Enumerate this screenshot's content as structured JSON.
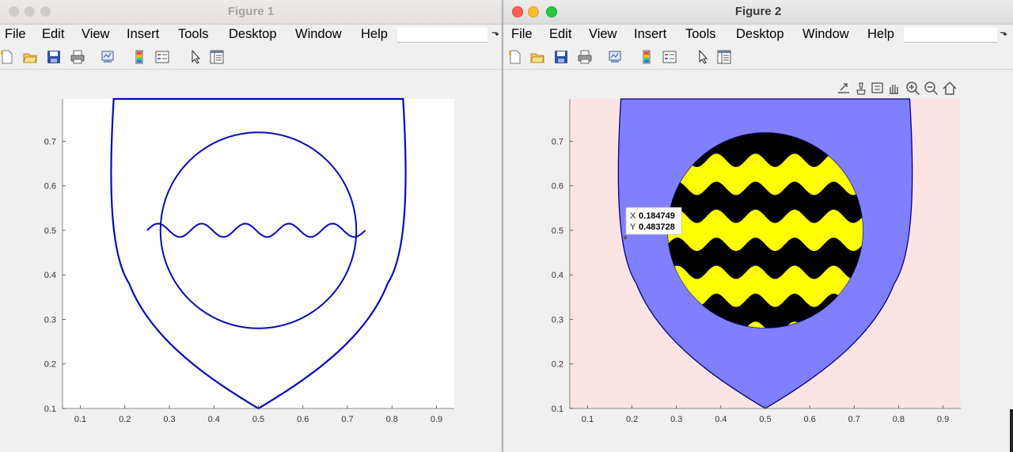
{
  "figure1": {
    "title": "Figure 1",
    "menu": [
      "File",
      "Edit",
      "View",
      "Insert",
      "Tools",
      "Desktop",
      "Window",
      "Help"
    ],
    "menu_overflow": "⬎",
    "toolbar_icons": [
      "new-figure-icon",
      "open-file-icon",
      "save-icon",
      "print-icon",
      "link-plot-icon",
      "insert-colorbar-icon",
      "insert-legend-icon",
      "edit-plot-icon",
      "property-inspector-icon"
    ],
    "colors": {
      "line": "#0a0ab4",
      "axes_bg": "#ffffff"
    }
  },
  "figure2": {
    "title": "Figure 2",
    "menu": [
      "File",
      "Edit",
      "View",
      "Insert",
      "Tools",
      "Desktop",
      "Window",
      "Help"
    ],
    "menu_overflow": "⬎",
    "toolbar_icons": [
      "new-figure-icon",
      "open-file-icon",
      "save-icon",
      "print-icon",
      "link-plot-icon",
      "insert-colorbar-icon",
      "insert-legend-icon",
      "edit-plot-icon",
      "property-inspector-icon"
    ],
    "axes_toolbar_icons": [
      "export-icon",
      "brush-icon",
      "data-tips-icon",
      "pan-icon",
      "zoom-in-icon",
      "zoom-out-icon",
      "home-icon"
    ],
    "datatip": {
      "x_label": "X",
      "x_value": "0.184749",
      "y_label": "Y",
      "y_value": "0.483728"
    },
    "colors": {
      "axes_bg": "#fde4e4",
      "shield_fill": "#8080ff",
      "edge": "#000080",
      "stripe_a": "#000000",
      "stripe_b": "#ffff00"
    }
  },
  "chart_data": [
    {
      "type": "line",
      "title": "",
      "xlabel": "",
      "ylabel": "",
      "xlim": [
        0.06,
        0.94
      ],
      "ylim": [
        0.1,
        0.795
      ],
      "xticks": [
        "0.1",
        "0.2",
        "0.3",
        "0.4",
        "0.5",
        "0.6",
        "0.7",
        "0.8",
        "0.9"
      ],
      "yticks": [
        "0.1",
        "0.2",
        "0.3",
        "0.4",
        "0.5",
        "0.6",
        "0.7"
      ],
      "series": [
        {
          "shape": "shield-outline",
          "top_y": 0.795,
          "top_x": [
            0.175,
            0.825
          ],
          "tip": [
            0.5,
            0.1
          ]
        },
        {
          "shape": "circle",
          "center": [
            0.5,
            0.5
          ],
          "radius": 0.22
        },
        {
          "shape": "wave",
          "x_range": [
            0.25,
            0.74
          ],
          "center_y": 0.5,
          "amplitude": 0.015,
          "cycles": 5
        }
      ],
      "grid": false
    },
    {
      "type": "area",
      "title": "",
      "xlabel": "",
      "ylabel": "",
      "xlim": [
        0.06,
        0.94
      ],
      "ylim": [
        0.1,
        0.795
      ],
      "xticks": [
        "0.1",
        "0.2",
        "0.3",
        "0.4",
        "0.5",
        "0.6",
        "0.7",
        "0.8",
        "0.9"
      ],
      "yticks": [
        "0.1",
        "0.2",
        "0.3",
        "0.4",
        "0.5",
        "0.6",
        "0.7"
      ],
      "series": [
        {
          "shape": "shield-filled",
          "top_y": 0.795,
          "top_x": [
            0.175,
            0.825
          ],
          "tip": [
            0.5,
            0.1
          ]
        },
        {
          "shape": "circle-striped",
          "center": [
            0.5,
            0.5
          ],
          "radius": 0.22,
          "bands": 7,
          "wave_amplitude": 0.015
        }
      ],
      "datatip_point": [
        0.184749,
        0.483728
      ],
      "grid": false
    }
  ]
}
